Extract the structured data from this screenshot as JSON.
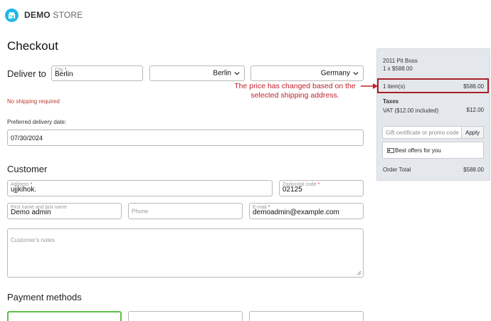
{
  "header": {
    "brand_bold": "DEMO",
    "brand_rest": "STORE",
    "logo_icon": "store-icon",
    "logo_color": "#1fb8e6"
  },
  "page": {
    "title": "Checkout"
  },
  "deliver": {
    "label": "Deliver to",
    "city_label": "City",
    "city_value": "Berlin",
    "region_value": "Berlin",
    "country_value": "Germany",
    "shipping_warning": "No shipping required",
    "date_label": "Preferred delivery date:",
    "date_value": "07/30/2024"
  },
  "customer": {
    "title": "Customer",
    "address_label": "Address",
    "address_value": "ujjkihok.",
    "zip_label": "Zip/postal code",
    "zip_value": "02125",
    "name_label": "First name and last name",
    "name_value": "Demo admin",
    "phone_placeholder": "Phone",
    "email_label": "E-mail",
    "email_value": "demoadmin@example.com",
    "notes_placeholder": "Customer's notes"
  },
  "payment": {
    "title": "Payment methods"
  },
  "summary": {
    "product_name": "2011 Pit Boss",
    "product_qty_price": "1 x $588.00",
    "items_label": "1 item(s)",
    "items_total": "$588.00",
    "taxes_title": "Taxes",
    "vat_label": "VAT ($12.00 included)",
    "vat_value": "$12.00",
    "gift_placeholder": "Gift certificate or promo code",
    "apply_label": "Apply",
    "offers_label": "Best offers for you",
    "order_total_label": "Order Total",
    "order_total_value": "$588.00"
  },
  "annotation": {
    "line1": "The price has changed based on the",
    "line2": "selected shipping address.",
    "color": "#c0202a"
  },
  "colors": {
    "required": "#c0392b",
    "sidebar_bg": "#e4e8ec",
    "active_border": "#5cc04a"
  }
}
